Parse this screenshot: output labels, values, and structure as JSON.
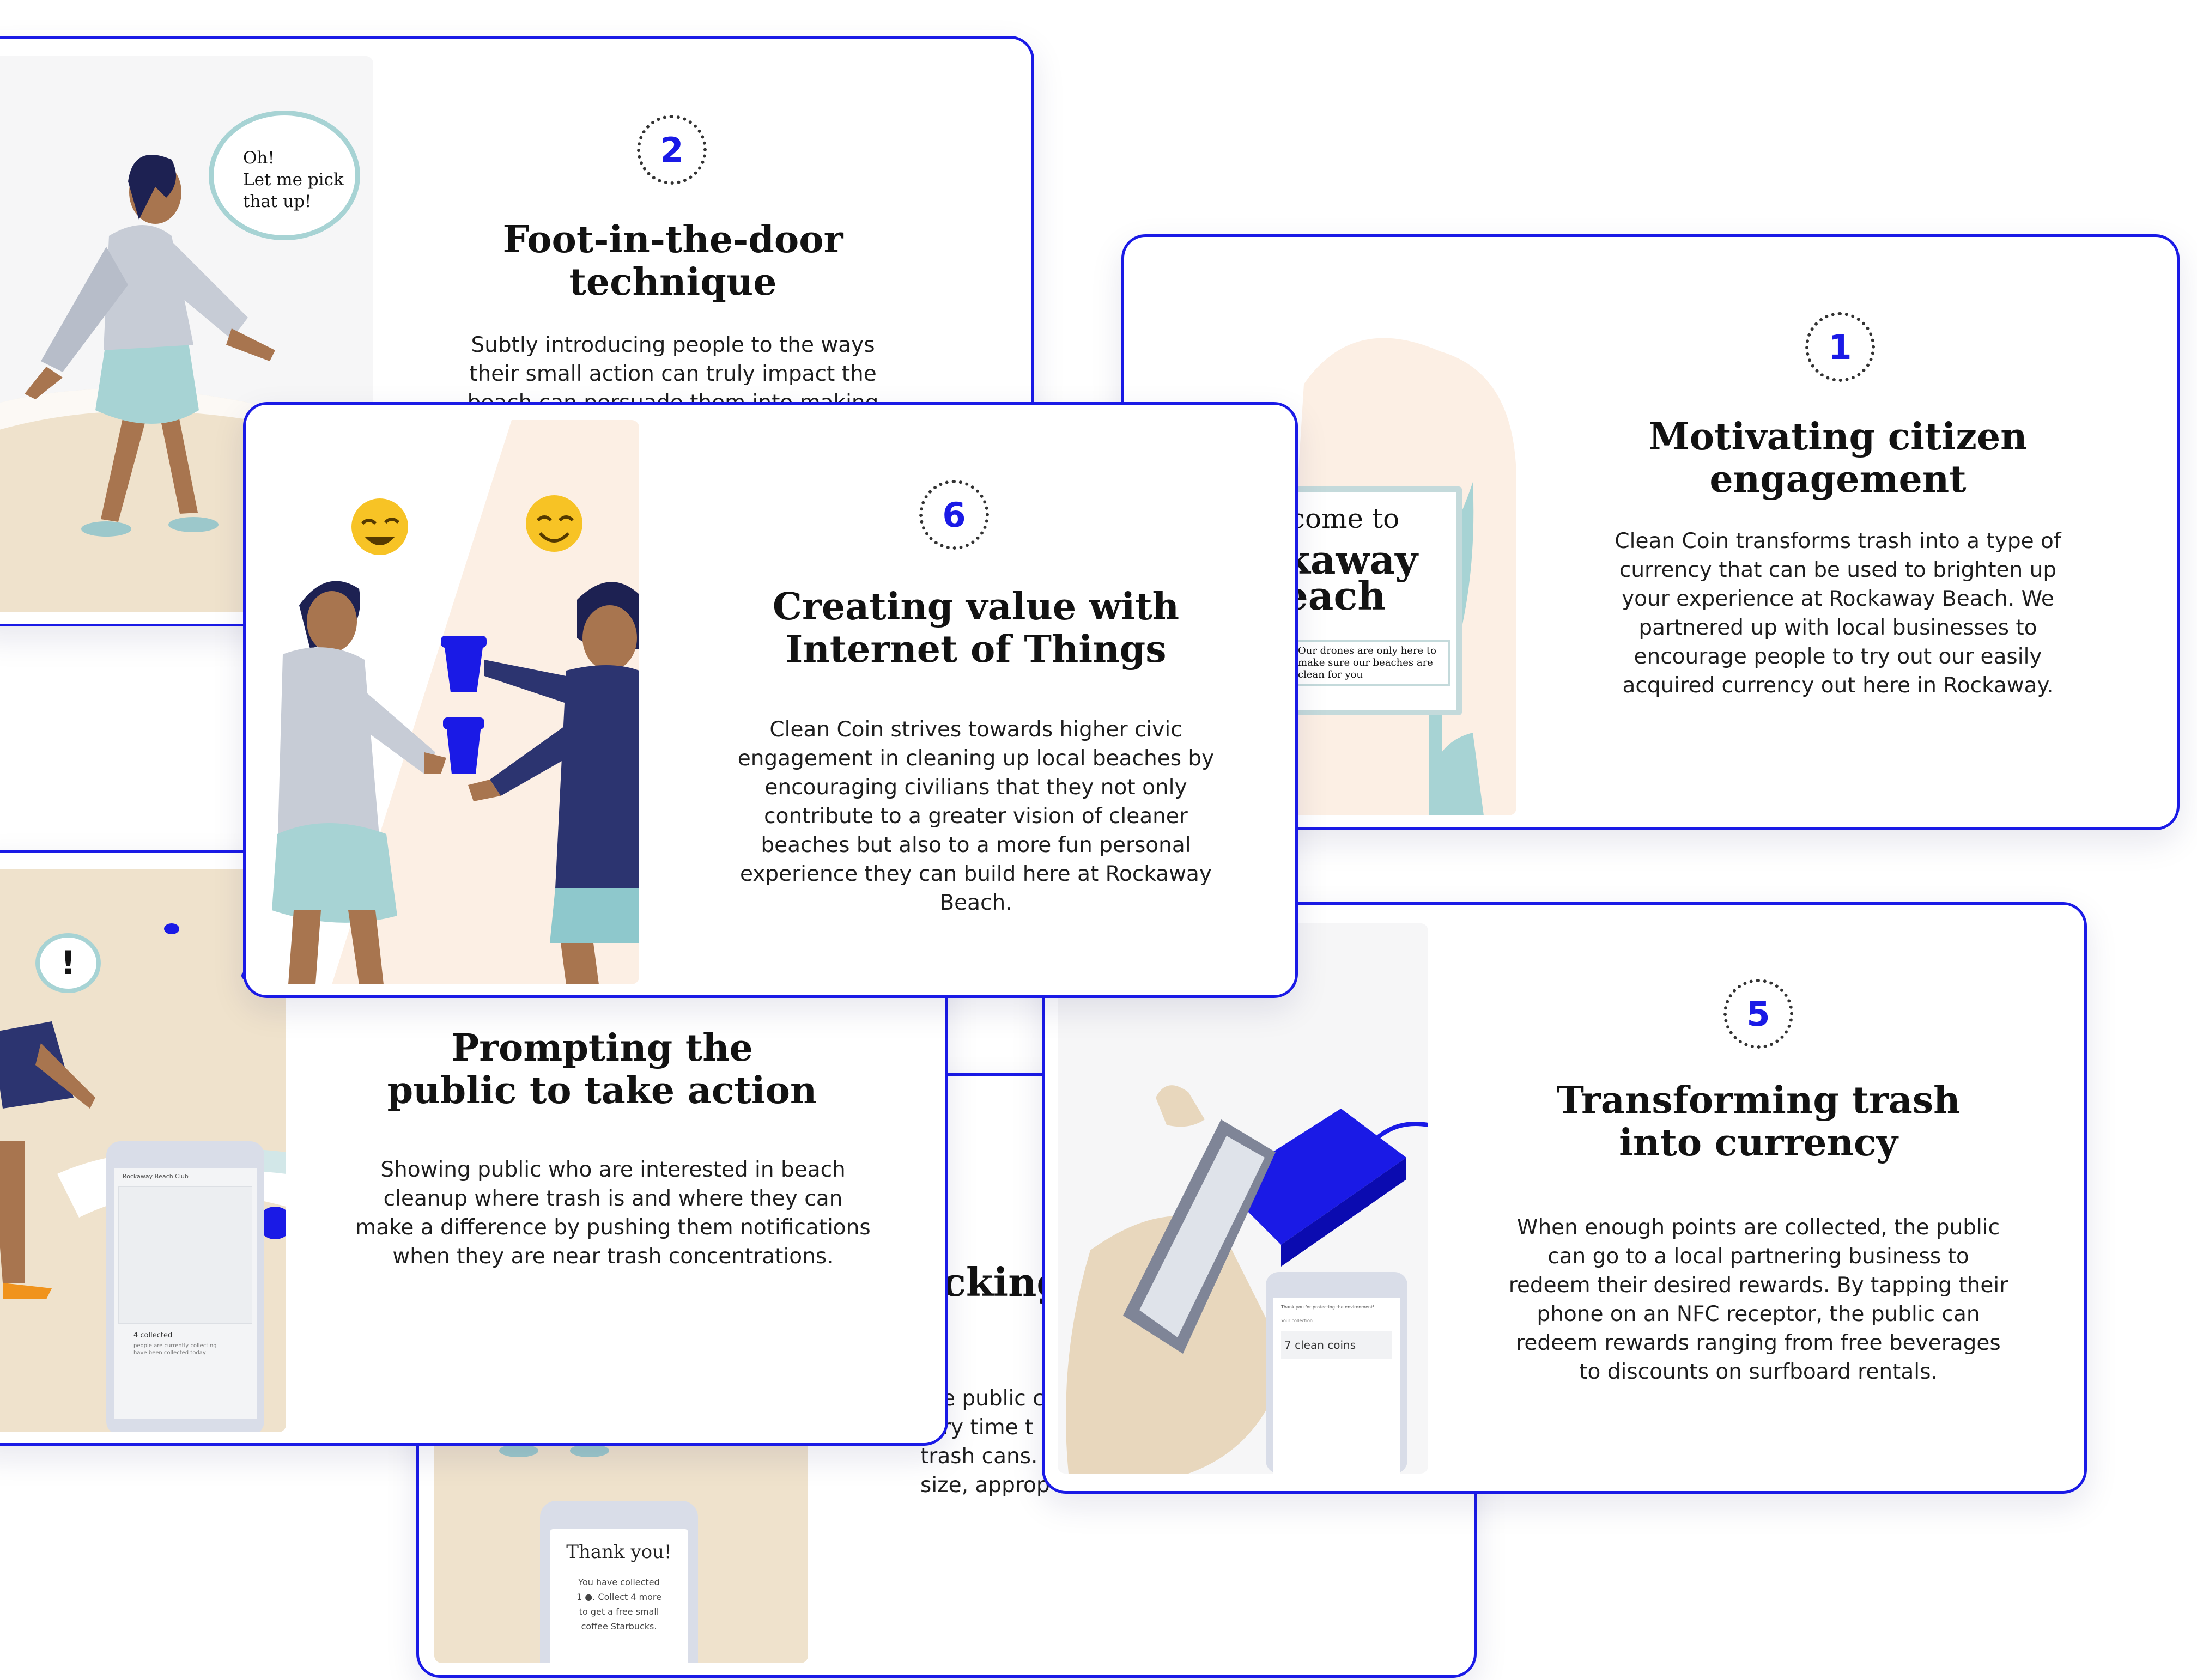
{
  "colors": {
    "accent": "#1a1ae6",
    "sand": "#efe2cc",
    "blush": "#fcefe4",
    "teal": "#a7d3d4",
    "navy": "#2c3470",
    "skin": "#a8754f"
  },
  "cards": {
    "c3": {
      "title_fragment": "cking",
      "desc_lines": [
        "e public c",
        "ry time t",
        "trash cans.",
        "size, approp"
      ],
      "phone_title": "Thank you!",
      "phone_lines": [
        "You have collected",
        "1 ●. Collect 4 more",
        "to get a free small",
        "coffee Starbucks."
      ]
    },
    "c2": {
      "number": "2",
      "title": "Foot-in-the-door technique",
      "desc": "Subtly introducing people to the ways their small action can truly impact the beach can persuade them into making more active",
      "bubble": [
        "Oh!",
        "Let me pick",
        "that up!"
      ]
    },
    "c1": {
      "number": "1",
      "title": "Motivating citizen engagement",
      "desc": "Clean Coin transforms trash into a type of currency that can be used to brighten up your experience at Rockaway Beach. We partnered up with local businesses to encourage people to try out our easily acquired currency out here in Rockaway.",
      "sign_line1": "come to",
      "sign_line2": "kaway",
      "sign_line3": "each",
      "sign_small": "Our drones are only here to make sure our beaches are clean for you"
    },
    "c4": {
      "title": "Prompting the public to take action",
      "desc": "Showing public who are interested in beach cleanup where trash is and where they can make a difference by pushing them notifications when they are near trash concentrations.",
      "bubble": "!",
      "map_header": "Rockaway Beach Club",
      "collected": "4 collected",
      "stat1": "people are currently collecting",
      "stat2": "have been collected today"
    },
    "c6": {
      "number": "6",
      "title": "Creating value with Internet of Things",
      "desc": "Clean Coin strives towards higher civic engagement in cleaning up local beaches by encouraging civilians that they not only contribute to a greater vision of cleaner beaches but also to a more fun personal experience they can build here at Rockaway Beach."
    },
    "c5": {
      "number": "5",
      "title": "Transforming trash into currency",
      "desc": "When enough points are collected, the public can go to a local partnering business to redeem their desired rewards. By tapping their phone on an NFC receptor, the public can redeem rewards ranging from free beverages to discounts on surfboard rentals.",
      "phone_header": "Thank you for protecting the environment!",
      "phone_sub": "Your collection",
      "coins": "7 clean coins"
    }
  }
}
